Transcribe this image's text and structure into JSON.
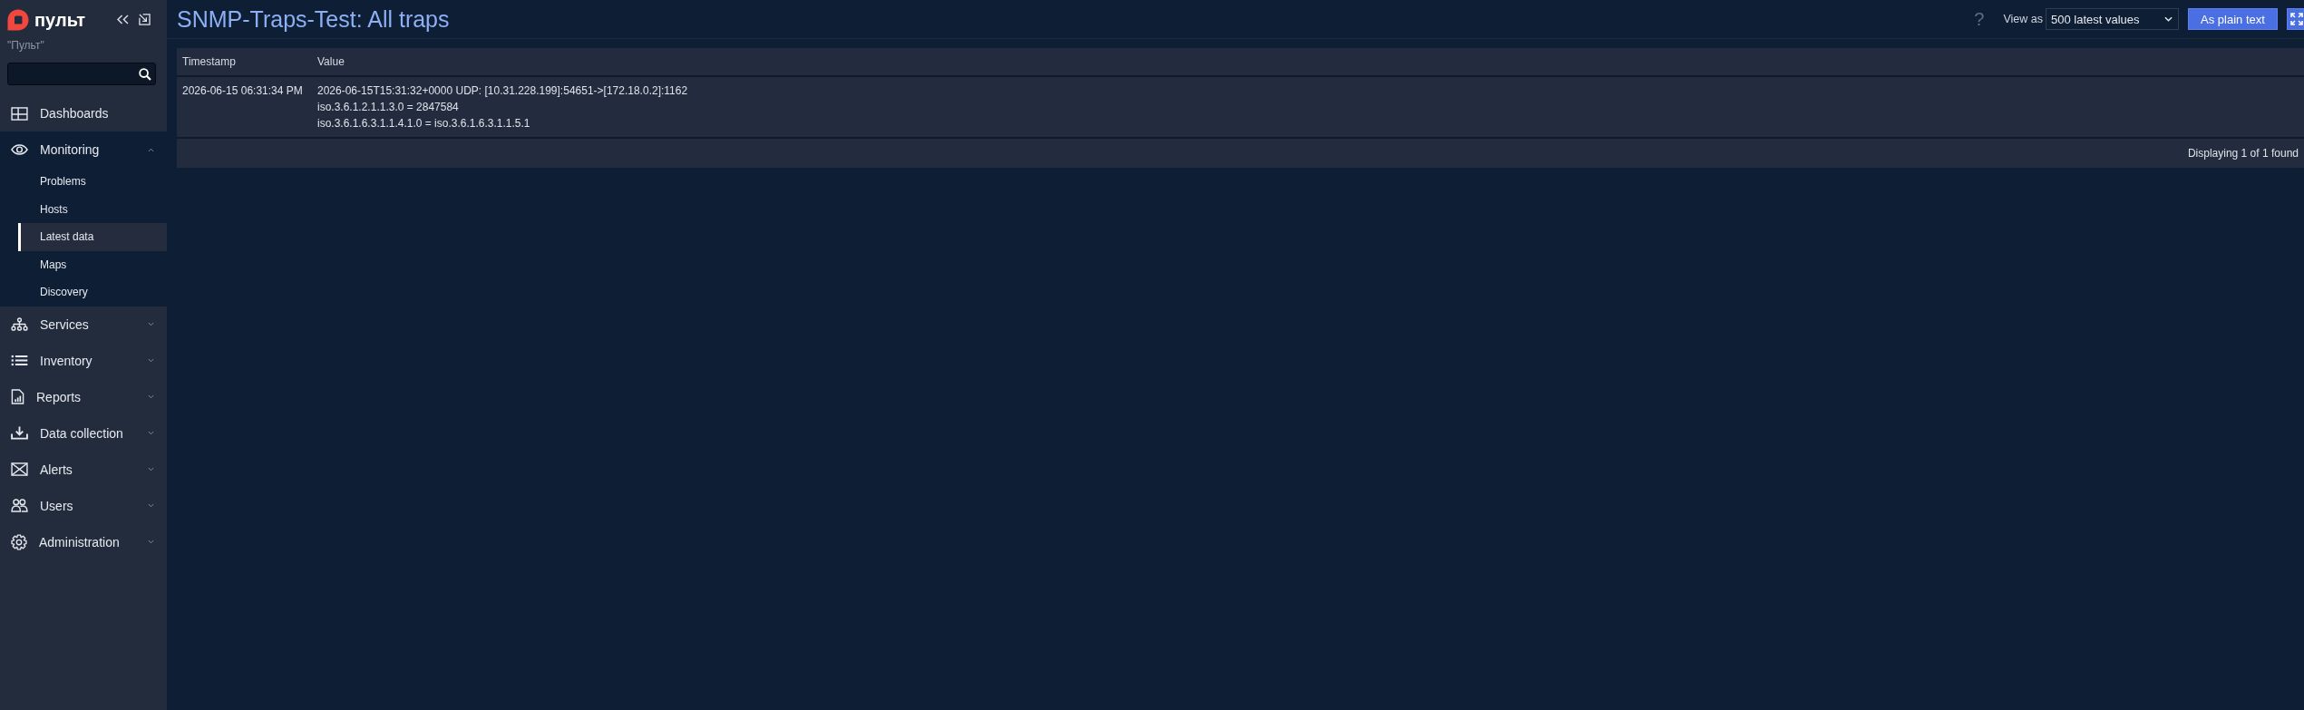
{
  "sidebar": {
    "logo_text": "пульт",
    "server_name": "\"Пульт\"",
    "menu": [
      {
        "label": "Dashboards"
      },
      {
        "label": "Monitoring",
        "expanded": true,
        "children": [
          {
            "label": "Problems",
            "selected": false
          },
          {
            "label": "Hosts",
            "selected": false
          },
          {
            "label": "Latest data",
            "selected": true
          },
          {
            "label": "Maps",
            "selected": false
          },
          {
            "label": "Discovery",
            "selected": false
          }
        ]
      },
      {
        "label": "Services",
        "expanded": false
      },
      {
        "label": "Inventory",
        "expanded": false
      },
      {
        "label": "Reports",
        "expanded": false
      },
      {
        "label": "Data collection",
        "expanded": false
      },
      {
        "label": "Alerts",
        "expanded": false
      },
      {
        "label": "Users",
        "expanded": false
      },
      {
        "label": "Administration",
        "expanded": false
      }
    ]
  },
  "header": {
    "title": "SNMP-Traps-Test: All traps",
    "help": "?",
    "view_as": {
      "label": "View as",
      "value": "500 latest values"
    },
    "buttons": [
      {
        "kind": "text",
        "label": "As plain text"
      },
      {
        "kind": "fullscreen"
      }
    ]
  },
  "table": {
    "columns": [
      "Timestamp",
      "Value"
    ],
    "rows": [
      {
        "cells": [
          "2026-06-15 06:31:34 PM",
          "2026-06-15T15:31:32+0000 UDP: [10.31.228.199]:54651->[172.18.0.2]:1162\niso.3.6.1.2.1.1.3.0 = 2847584\niso.3.6.1.6.3.1.1.4.1.0 = iso.3.6.1.6.3.1.1.5.1"
        ]
      }
    ],
    "footer": "Displaying 1 of 1 found"
  }
}
